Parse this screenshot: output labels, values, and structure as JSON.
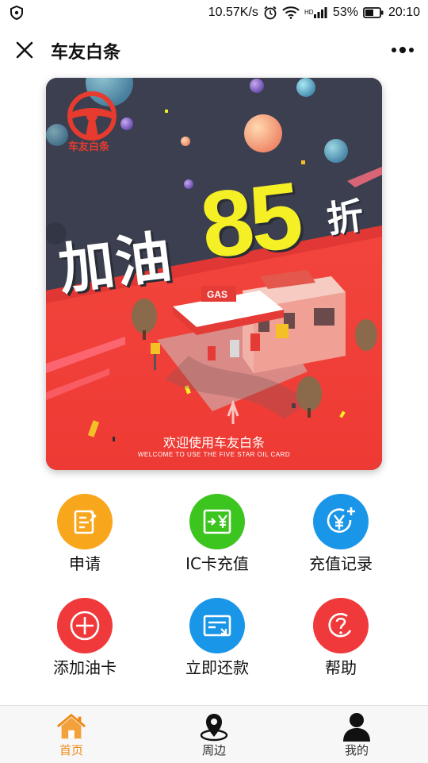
{
  "status_bar": {
    "network_speed": "10.57K/s",
    "battery_percent": "53%",
    "time": "20:10",
    "icons": [
      "shield-icon",
      "alarm-icon",
      "wifi-icon",
      "signal-icon",
      "battery-icon"
    ]
  },
  "header": {
    "title": "车友白条",
    "close_icon": "close-icon",
    "more_icon": "more-icon"
  },
  "banner": {
    "logo_text": "车友白条",
    "headline": "加油",
    "discount_number": "85",
    "discount_unit": "折",
    "welcome_text": "欢迎使用车友白条",
    "welcome_text_en": "WELCOME TO USE THE FIVE STAR OIL CARD",
    "sign_text": "GAS",
    "colors": {
      "dark": "#3b3f4f",
      "red": "#f0393a",
      "yellow": "#f5f025"
    }
  },
  "menu": {
    "items": [
      {
        "label": "申请",
        "icon": "document-edit-icon",
        "color": "#f8a61b"
      },
      {
        "label": "IC卡充值",
        "icon": "card-yen-icon",
        "color": "#3cc51f"
      },
      {
        "label": "充值记录",
        "icon": "yen-plus-icon",
        "color": "#1a96e8"
      },
      {
        "label": "添加油卡",
        "icon": "circle-plus-icon",
        "color": "#f0393a"
      },
      {
        "label": "立即还款",
        "icon": "card-repay-icon",
        "color": "#1a96e8"
      },
      {
        "label": "帮助",
        "icon": "question-icon",
        "color": "#f0393a"
      }
    ]
  },
  "tab_bar": {
    "tabs": [
      {
        "label": "首页",
        "icon": "home-icon",
        "active": true
      },
      {
        "label": "周边",
        "icon": "location-pin-icon",
        "active": false
      },
      {
        "label": "我的",
        "icon": "user-icon",
        "active": false
      }
    ],
    "active_color": "#ef8a16"
  }
}
